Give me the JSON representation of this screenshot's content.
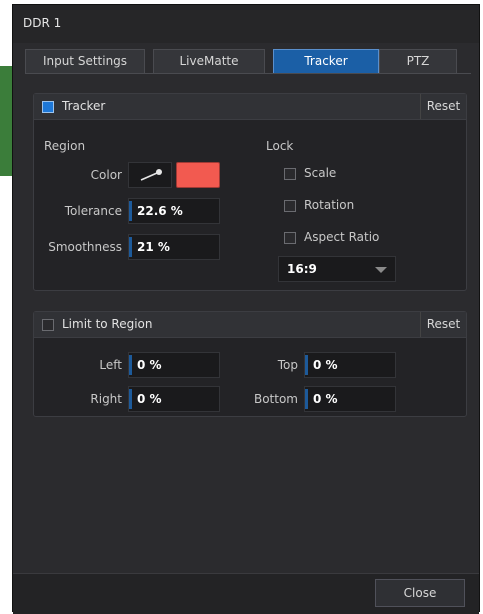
{
  "window": {
    "title": "DDR 1"
  },
  "tabs": [
    {
      "label": "Input Settings"
    },
    {
      "label": "LiveMatte"
    },
    {
      "label": "Tracker",
      "active": true
    },
    {
      "label": "PTZ"
    }
  ],
  "tracker_panel": {
    "enabled_label": "Tracker",
    "enabled": true,
    "reset_label": "Reset",
    "region_heading": "Region",
    "color_label": "Color",
    "color_value": "#f25a50",
    "tolerance_label": "Tolerance",
    "tolerance_value": "22.6 %",
    "smoothness_label": "Smoothness",
    "smoothness_value": "21 %",
    "lock_heading": "Lock",
    "lock_scale_label": "Scale",
    "lock_rotation_label": "Rotation",
    "lock_aspect_label": "Aspect Ratio",
    "aspect_value": "16:9"
  },
  "limit_panel": {
    "enabled_label": "Limit to Region",
    "enabled": false,
    "reset_label": "Reset",
    "left_label": "Left",
    "left_value": "0 %",
    "right_label": "Right",
    "right_value": "0 %",
    "top_label": "Top",
    "top_value": "0 %",
    "bottom_label": "Bottom",
    "bottom_value": "0 %"
  },
  "footer": {
    "close_label": "Close"
  },
  "icons": {
    "picker": "eyedropper-icon",
    "dropdown": "chevron-down-icon"
  },
  "colors": {
    "accent": "#1b5fa6",
    "checkbox_on": "#1e78d8",
    "swatch": "#f25a50",
    "background": "#2b2b2e"
  }
}
